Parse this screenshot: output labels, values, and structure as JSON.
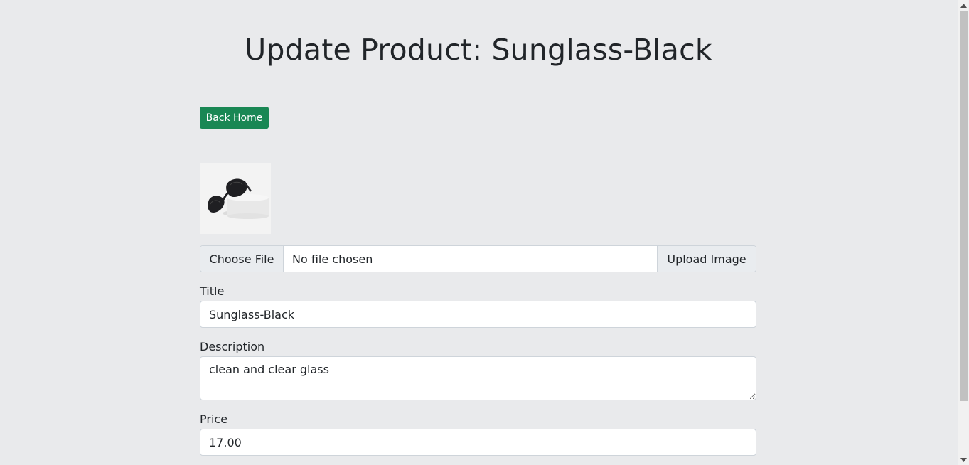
{
  "page": {
    "title": "Update Product: Sunglass-Black"
  },
  "actions": {
    "back_label": "Back Home"
  },
  "image_upload": {
    "choose_label": "Choose File",
    "file_status": "No file chosen",
    "upload_label": "Upload Image"
  },
  "form": {
    "title_label": "Title",
    "title_value": "Sunglass-Black",
    "description_label": "Description",
    "description_value": "clean and clear glass",
    "price_label": "Price",
    "price_value": "17.00"
  },
  "colors": {
    "accent": "#198754",
    "background": "#e9eaec"
  },
  "icons": {
    "product_image": "sunglasses-image"
  }
}
